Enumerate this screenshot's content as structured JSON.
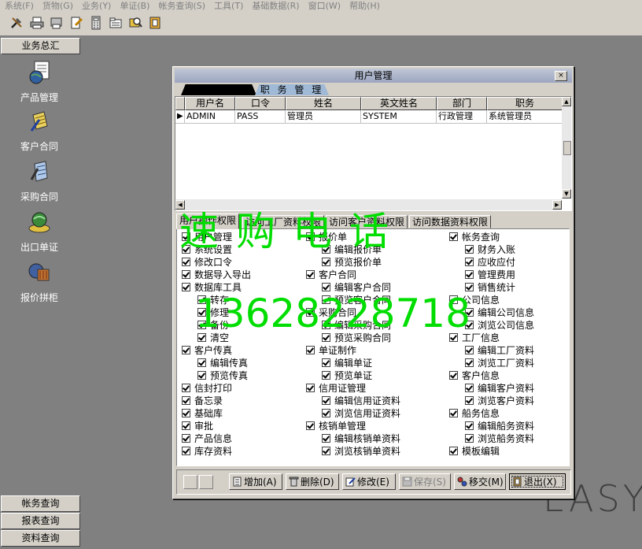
{
  "menu": [
    "系统(F)",
    "货物(G)",
    "业务(Y)",
    "单证(B)",
    "帐务查询(S)",
    "工具(T)",
    "基础数据(R)",
    "窗口(W)",
    "帮助(H)"
  ],
  "toolbar_icons": [
    "tools-icon",
    "printer-icon",
    "print-preview-icon",
    "edit-document-icon",
    "calculator-icon",
    "folder-icon",
    "search-icon",
    "help-icon"
  ],
  "sidebar": {
    "header": "业务总汇",
    "items": [
      {
        "label": "产品管理",
        "icon": "globe-document-icon"
      },
      {
        "label": "客户合同",
        "icon": "contract-pencil-icon"
      },
      {
        "label": "采购合同",
        "icon": "purchase-contract-icon"
      },
      {
        "label": "出口单证",
        "icon": "export-globe-icon"
      },
      {
        "label": "报价拼柜",
        "icon": "container-icon"
      }
    ],
    "bottom_buttons": [
      "帐务查询",
      "报表查询",
      "资料查询"
    ]
  },
  "watermark_bg": "EASY",
  "dialog": {
    "title": "用户管理",
    "close_label": "×",
    "top_tabs": [
      "",
      "职 务 管 理"
    ],
    "grid": {
      "columns": [
        "用户名",
        "口令",
        "姓名",
        "英文姓名",
        "部门",
        "职务"
      ],
      "rows": [
        {
          "indicator": "▶",
          "cells": [
            "ADMIN",
            "PASS",
            "管理员",
            "SYSTEM",
            "行政管理",
            "系统管理员"
          ]
        }
      ]
    },
    "perm_tabs": [
      "用户操作权限",
      "访问工厂资料权限",
      "访问客户资料权限",
      "访问数据资料权限"
    ],
    "permissions": {
      "col1": [
        {
          "label": "用户管理",
          "level": 0
        },
        {
          "label": "系统设置",
          "level": 0
        },
        {
          "label": "修改口令",
          "level": 0
        },
        {
          "label": "数据导入导出",
          "level": 0
        },
        {
          "label": "数据库工具",
          "level": 0
        },
        {
          "label": "转存",
          "level": 1
        },
        {
          "label": "修理",
          "level": 1
        },
        {
          "label": "备份",
          "level": 1
        },
        {
          "label": "清空",
          "level": 1
        },
        {
          "label": "客户传真",
          "level": 0
        },
        {
          "label": "编辑传真",
          "level": 1
        },
        {
          "label": "预览传真",
          "level": 1
        },
        {
          "label": "信封打印",
          "level": 0
        },
        {
          "label": "备忘录",
          "level": 0
        },
        {
          "label": "基础库",
          "level": 0
        },
        {
          "label": "审批",
          "level": 0
        },
        {
          "label": "产品信息",
          "level": 0
        },
        {
          "label": "库存资料",
          "level": 0
        }
      ],
      "col2": [
        {
          "label": "报价单",
          "level": 0
        },
        {
          "label": "编辑报价单",
          "level": 1
        },
        {
          "label": "预览报价单",
          "level": 1
        },
        {
          "label": "客户合同",
          "level": 0
        },
        {
          "label": "编辑客户合同",
          "level": 1
        },
        {
          "label": "预览客户合同",
          "level": 1
        },
        {
          "label": "采购合同",
          "level": 0
        },
        {
          "label": "编辑采购合同",
          "level": 1
        },
        {
          "label": "预览采购合同",
          "level": 1
        },
        {
          "label": "单证制作",
          "level": 0
        },
        {
          "label": "编辑单证",
          "level": 1
        },
        {
          "label": "预览单证",
          "level": 1
        },
        {
          "label": "信用证管理",
          "level": 0
        },
        {
          "label": "编辑信用证资料",
          "level": 1
        },
        {
          "label": "浏览信用证资料",
          "level": 1
        },
        {
          "label": "核销单管理",
          "level": 0
        },
        {
          "label": "编辑核销单资料",
          "level": 1
        },
        {
          "label": "浏览核销单资料",
          "level": 1
        }
      ],
      "col3": [
        {
          "label": "帐务查询",
          "level": 0
        },
        {
          "label": "财务入账",
          "level": 1
        },
        {
          "label": "应收应付",
          "level": 1
        },
        {
          "label": "管理费用",
          "level": 1
        },
        {
          "label": "销售统计",
          "level": 1
        },
        {
          "label": "公司信息",
          "level": 0
        },
        {
          "label": "编辑公司信息",
          "level": 1
        },
        {
          "label": "浏览公司信息",
          "level": 1
        },
        {
          "label": "工厂信息",
          "level": 0
        },
        {
          "label": "编辑工厂资料",
          "level": 1
        },
        {
          "label": "浏览工厂资料",
          "level": 1
        },
        {
          "label": "客户信息",
          "level": 0
        },
        {
          "label": "编辑客户资料",
          "level": 1
        },
        {
          "label": "浏览客户资料",
          "level": 1
        },
        {
          "label": "船务信息",
          "level": 0
        },
        {
          "label": "编辑船务资料",
          "level": 1
        },
        {
          "label": "浏览船务资料",
          "level": 1
        },
        {
          "label": "模板编辑",
          "level": 0
        }
      ]
    },
    "buttons": [
      {
        "label": "增加(A)",
        "icon": "add-icon",
        "disabled": false
      },
      {
        "label": "删除(D)",
        "icon": "delete-icon",
        "disabled": false
      },
      {
        "label": "修改(E)",
        "icon": "edit-icon",
        "disabled": false
      },
      {
        "label": "保存(S)",
        "icon": "save-icon",
        "disabled": true
      },
      {
        "label": "移交(M)",
        "icon": "transfer-icon",
        "disabled": false
      },
      {
        "label": "退出(X)",
        "icon": "exit-icon",
        "disabled": false
      }
    ]
  },
  "overlay_watermark": {
    "line1": "速购电话",
    "line2": "13628228718"
  },
  "colors": {
    "watermark": "#00dd00",
    "title_bar": "#9ca6c0",
    "tab_blue": "#9fb9d6"
  }
}
